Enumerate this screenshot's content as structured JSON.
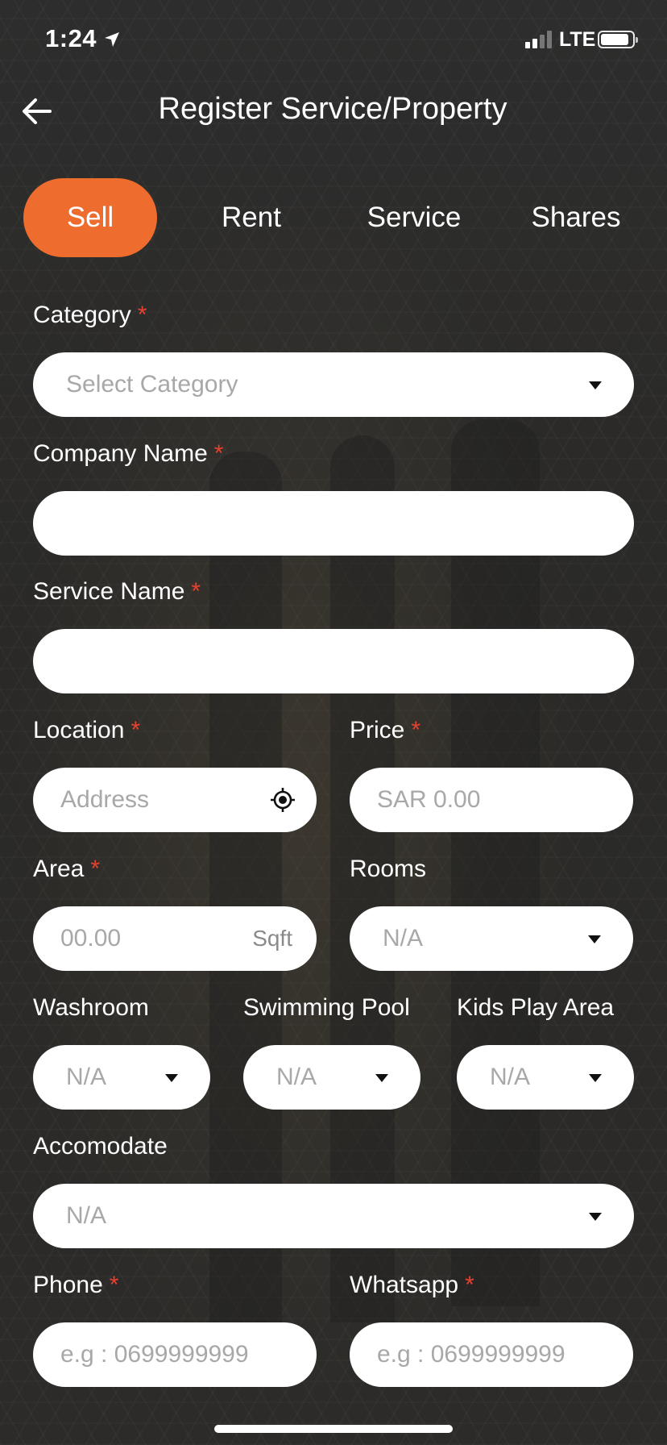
{
  "status_bar": {
    "time": "1:24",
    "network": "LTE"
  },
  "header": {
    "title": "Register Service/Property"
  },
  "tabs": [
    {
      "label": "Sell",
      "active": true
    },
    {
      "label": "Rent",
      "active": false
    },
    {
      "label": "Service",
      "active": false
    },
    {
      "label": "Shares",
      "active": false
    }
  ],
  "form": {
    "category": {
      "label": "Category",
      "required": "*",
      "placeholder": "Select Category"
    },
    "company_name": {
      "label": "Company Name",
      "required": "*",
      "value": ""
    },
    "service_name": {
      "label": "Service Name",
      "required": "*",
      "value": ""
    },
    "location": {
      "label": "Location",
      "required": "*",
      "placeholder": "Address"
    },
    "price": {
      "label": "Price",
      "required": "*",
      "placeholder": "SAR 0.00"
    },
    "area": {
      "label": "Area",
      "required": "*",
      "placeholder": "00.00",
      "unit": "Sqft"
    },
    "rooms": {
      "label": "Rooms",
      "value": "N/A"
    },
    "washroom": {
      "label": "Washroom",
      "value": "N/A"
    },
    "swimming_pool": {
      "label": "Swimming Pool",
      "value": "N/A"
    },
    "kids_play_area": {
      "label": "Kids Play Area",
      "value": "N/A"
    },
    "accomodate": {
      "label": "Accomodate",
      "value": "N/A"
    },
    "phone": {
      "label": "Phone",
      "required": "*",
      "placeholder": "e.g : 0699999999"
    },
    "whatsapp": {
      "label": "Whatsapp",
      "required": "*",
      "placeholder": "e.g : 0699999999"
    }
  },
  "colors": {
    "accent": "#ee6c2d",
    "required": "#e8402f",
    "background": "#2b2b2b"
  }
}
